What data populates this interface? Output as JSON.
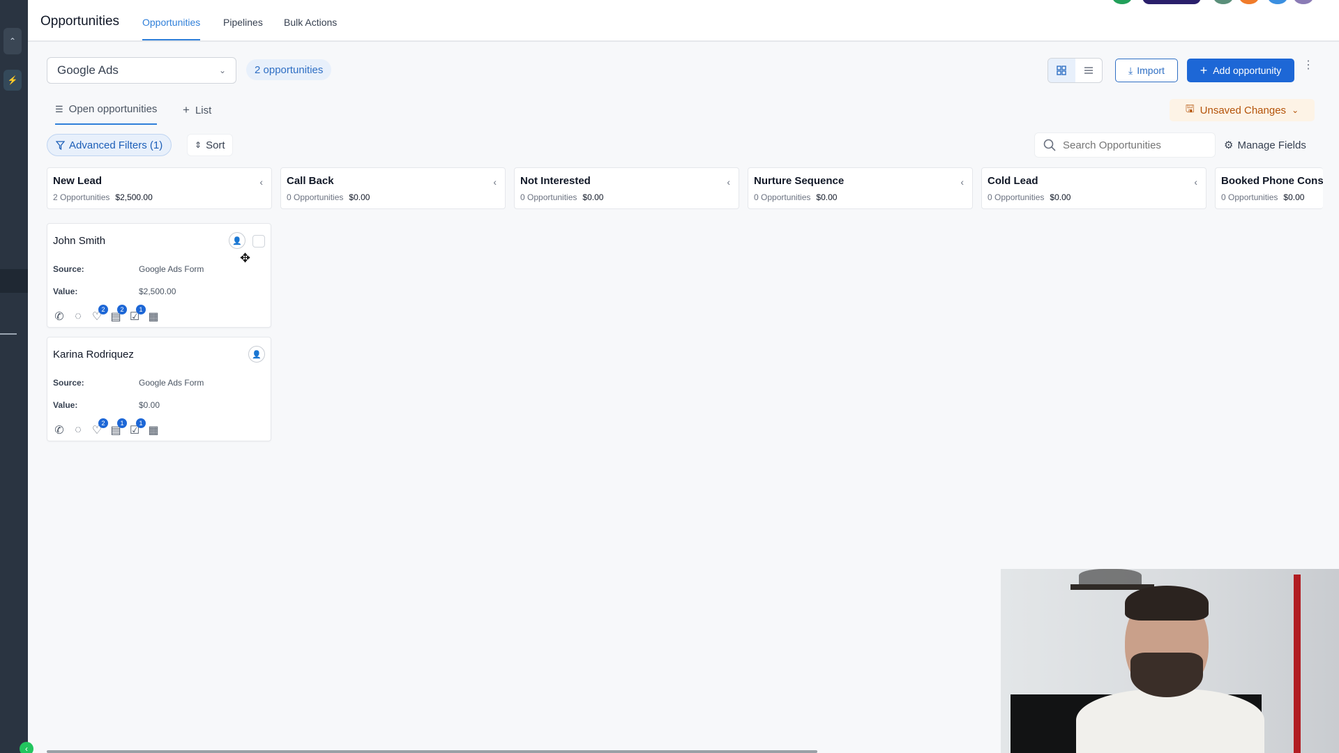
{
  "header": {
    "title": "Opportunities",
    "tabs": [
      {
        "label": "Opportunities",
        "active": true
      },
      {
        "label": "Pipelines",
        "active": false
      },
      {
        "label": "Bulk Actions",
        "active": false
      }
    ]
  },
  "toolbar": {
    "pipeline_value": "Google Ads",
    "opportunity_count": "2 opportunities",
    "import_label": "Import",
    "add_label": "Add opportunity"
  },
  "subtabs": {
    "open_label": "Open opportunities",
    "list_label": "List",
    "unsaved_label": "Unsaved Changes"
  },
  "filters": {
    "advanced_label": "Advanced Filters (1)",
    "sort_label": "Sort",
    "search_placeholder": "Search Opportunities",
    "manage_label": "Manage Fields"
  },
  "columns": [
    {
      "title": "New Lead",
      "count": "2 Opportunities",
      "amount": "$2,500.00"
    },
    {
      "title": "Call Back",
      "count": "0 Opportunities",
      "amount": "$0.00"
    },
    {
      "title": "Not Interested",
      "count": "0 Opportunities",
      "amount": "$0.00"
    },
    {
      "title": "Nurture Sequence",
      "count": "0 Opportunities",
      "amount": "$0.00"
    },
    {
      "title": "Cold Lead",
      "count": "0 Opportunities",
      "amount": "$0.00"
    },
    {
      "title": "Booked Phone Cons",
      "count": "0 Opportunities",
      "amount": "$0.00"
    }
  ],
  "cards": [
    {
      "name": "John Smith",
      "source_label": "Source:",
      "source": "Google Ads Form",
      "value_label": "Value:",
      "value": "$2,500.00",
      "badges": {
        "tags": "2",
        "notes": "2",
        "tasks": "1"
      }
    },
    {
      "name": "Karina Rodriquez",
      "source_label": "Source:",
      "source": "Google Ads Form",
      "value_label": "Value:",
      "value": "$0.00",
      "badges": {
        "tags": "2",
        "notes": "1",
        "tasks": "1"
      }
    }
  ],
  "colors": {
    "accent": "#2f7fd9",
    "primary_button": "#1d67d6",
    "rail": "#2a3441",
    "warning": "#b45309"
  },
  "avatars": [
    "#22a05a",
    "#2a1f6b",
    "#5a8f7a",
    "#f07b2a",
    "#3b8fe0",
    "#8a7bb5"
  ]
}
